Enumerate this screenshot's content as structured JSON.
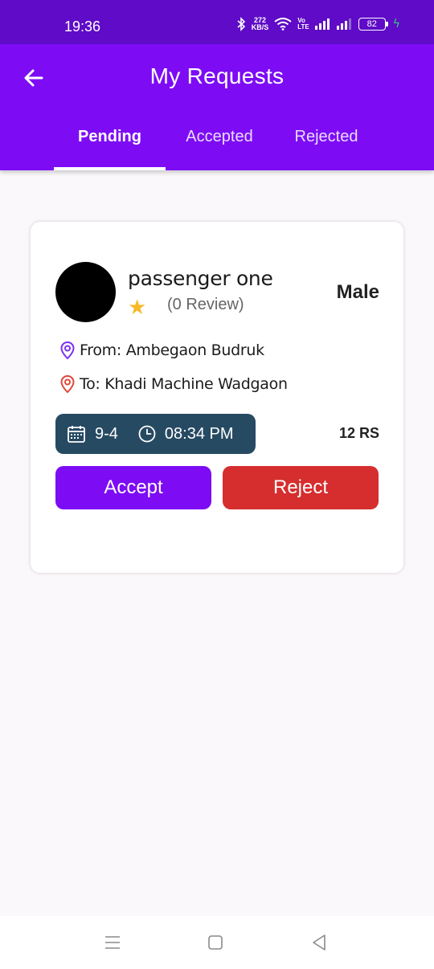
{
  "status_bar": {
    "time": "19:36",
    "net_speed_value": "272",
    "net_speed_unit": "KB/S",
    "volte_top": "Vo",
    "volte_bottom": "LTE",
    "battery": "82"
  },
  "header": {
    "title": "My Requests",
    "tabs": [
      {
        "label": "Pending"
      },
      {
        "label": "Accepted"
      },
      {
        "label": "Rejected"
      }
    ]
  },
  "request": {
    "name": "passenger one",
    "reviews": "(0 Review)",
    "gender": "Male",
    "from": "From: Ambegaon Budruk",
    "to": "To: Khadi Machine Wadgaon",
    "date": "9-4",
    "time": "08:34 PM",
    "price": "12 RS",
    "accept_label": "Accept",
    "reject_label": "Reject"
  },
  "colors": {
    "status_bar": "#5f0bc7",
    "brand": "#7d0cf5",
    "reject": "#d62e2e",
    "datetime_bg": "#274a63",
    "star": "#f6b92b",
    "from_pin": "#7d2ff0",
    "to_pin": "#e0483c"
  },
  "icons": {
    "back": "arrow-left-icon",
    "star": "star-icon",
    "from": "location-pin-icon",
    "to": "location-pin-icon",
    "date": "calendar-icon",
    "time": "clock-icon"
  }
}
